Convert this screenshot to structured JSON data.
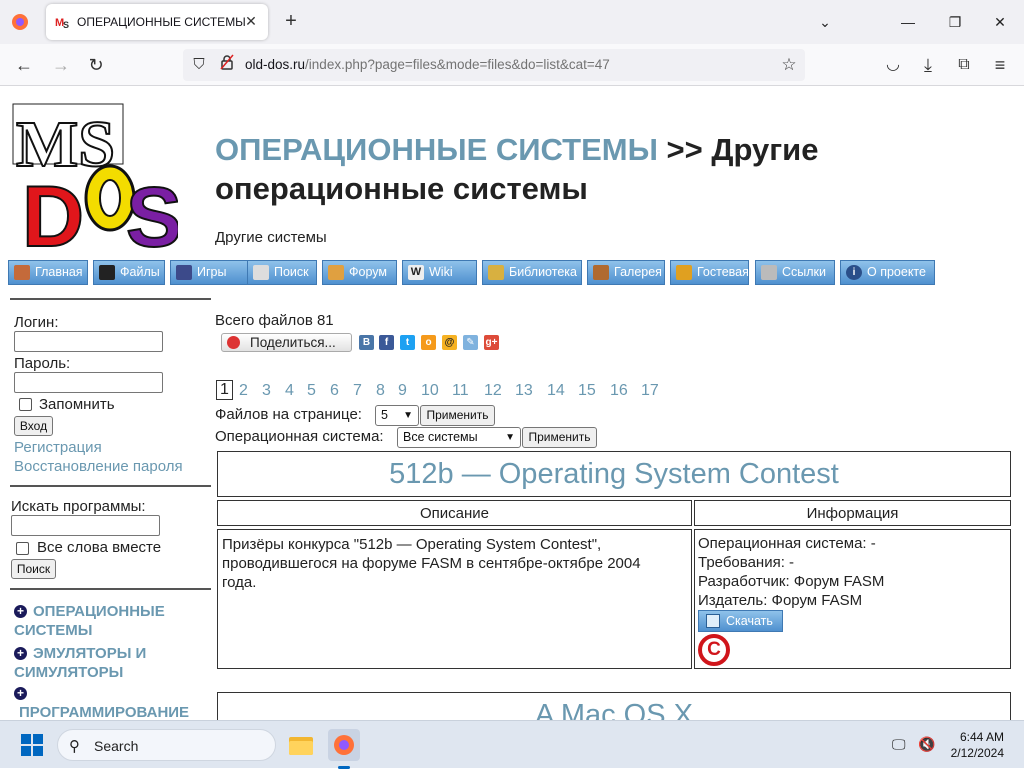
{
  "browser": {
    "tab_title": "ОПЕРАЦИОННЫЕ СИСТЕМЫ >> Други",
    "url_host": "old-dos.ru",
    "url_path": "/index.php?page=files&mode=files&do=list&cat=47"
  },
  "header": {
    "title_link": "ОПЕРАЦИОННЫЕ СИСТЕМЫ",
    "title_rest": " >> Другие операционные системы",
    "subtitle": "Другие системы"
  },
  "menu": [
    {
      "label": "Главная",
      "icon": "home-icon",
      "color": "#c46a3a"
    },
    {
      "label": "Файлы",
      "icon": "terminal-icon",
      "color": "#222222"
    },
    {
      "label": "Игры",
      "icon": "space-invader-icon",
      "color": "#3c4a8a"
    },
    {
      "label": "Поиск",
      "icon": "magnifier-icon",
      "color": "#dddddd"
    },
    {
      "label": "Форум",
      "icon": "user-icon",
      "color": "#e0a040"
    },
    {
      "label": "Wiki",
      "icon": "wikipedia-icon",
      "color": "#eeeeee"
    },
    {
      "label": "Библиотека",
      "icon": "book-icon",
      "color": "#d8b040"
    },
    {
      "label": "Галерея",
      "icon": "picture-icon",
      "color": "#b06a30"
    },
    {
      "label": "Гостевая",
      "icon": "guestbook-icon",
      "color": "#e0a020"
    },
    {
      "label": "Ссылки",
      "icon": "link-icon",
      "color": "#bbbbbb"
    },
    {
      "label": "О проекте",
      "icon": "info-icon",
      "color": "#2a4f8a"
    }
  ],
  "sidebar": {
    "login_label": "Логин:",
    "password_label": "Пароль:",
    "remember_label": "Запомнить",
    "login_button": "Вход",
    "register_link": "Регистрация",
    "restore_link": "Восстановление пароля",
    "search_label": "Искать программы:",
    "all_words_label": "Все слова вместе",
    "search_button": "Поиск",
    "categories": [
      "ОПЕРАЦИОННЫЕ СИСТЕМЫ",
      "ЭМУЛЯТОРЫ И СИМУЛЯТОРЫ",
      "ПРОГРАММИРОВАНИЕ"
    ]
  },
  "content": {
    "total_files": "Всего файлов 81",
    "share_button": "Поделиться...",
    "pages": [
      "1",
      "2",
      "3",
      "4",
      "5",
      "6",
      "7",
      "8",
      "9",
      "10",
      "11",
      "12",
      "13",
      "14",
      "15",
      "16",
      "17"
    ],
    "current_page": "1",
    "per_page_label": "Файлов на странице:",
    "per_page_value": "5",
    "apply_button": "Применить",
    "os_label": "Операционная система:",
    "os_value": "Все системы",
    "apply_button_2": "Применить",
    "program": {
      "title": "512b — Operating System Contest",
      "col_desc": "Описание",
      "col_info": "Информация",
      "description": "Призёры конкурса \"512b — Operating System Contest\", проводившегося на форуме FASM в сентябре-октябре 2004 года.",
      "os": "Операционная система: -",
      "requirements": "Требования: -",
      "developer": "Разработчик: Форум FASM",
      "publisher": "Издатель: Форум FASM",
      "download_button": "Скачать"
    },
    "next_program_title": "A Mac OS X"
  },
  "taskbar": {
    "search_placeholder": "Search",
    "time": "6:44 AM",
    "date": "2/12/2024"
  }
}
